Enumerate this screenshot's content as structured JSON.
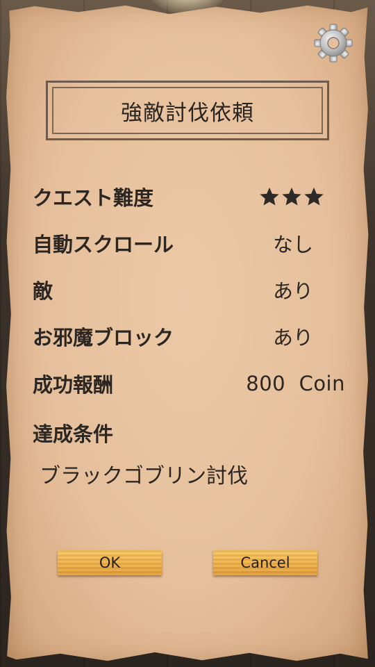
{
  "title": "強敵討伐依頼",
  "rows": [
    {
      "label": "クエスト難度",
      "value": "★★★",
      "stars": 3
    },
    {
      "label": "自動スクロール",
      "value": "なし"
    },
    {
      "label": "敵",
      "value": "あり"
    },
    {
      "label": "お邪魔ブロック",
      "value": "あり"
    },
    {
      "label": "成功報酬",
      "value": "800  Coin"
    }
  ],
  "condition": {
    "label": "達成条件",
    "value": "ブラックゴブリン討伐"
  },
  "buttons": {
    "ok": "OK",
    "cancel": "Cancel"
  },
  "colors": {
    "parchment": "#e6c09c",
    "text": "#2b2622",
    "button": "#eeb24c"
  },
  "icons": {
    "settings": "gear-icon",
    "difficulty": "star-icon"
  }
}
